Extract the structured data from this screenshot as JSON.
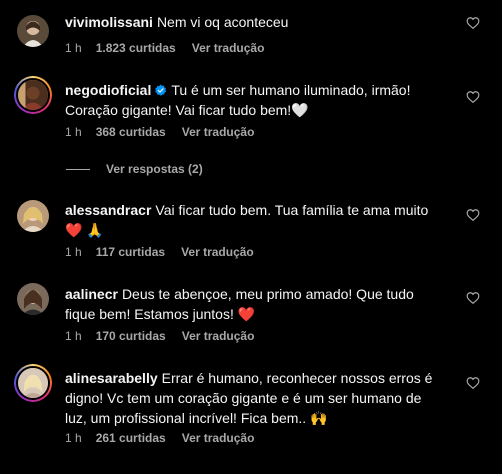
{
  "comments": [
    {
      "username": "vivimolissani",
      "text": "Nem vi oq aconteceu",
      "time": "1 h",
      "likes": "1.823 curtidas",
      "translate": "Ver tradução"
    },
    {
      "username": "negodioficial",
      "verified": true,
      "text": "Tu é um ser humano iluminado, irmão! Coração gigante! Vai ficar tudo bem!🤍",
      "time": "1 h",
      "likes": "368 curtidas",
      "translate": "Ver tradução",
      "replies": "Ver respostas (2)"
    },
    {
      "username": "alessandracr",
      "text": "Vai ficar tudo bem. Tua família te ama muito ❤️ 🙏",
      "time": "1 h",
      "likes": "117 curtidas",
      "translate": "Ver tradução"
    },
    {
      "username": "aalinecr",
      "text": "Deus te abençoe, meu primo amado! Que tudo fique bem! Estamos juntos! ❤️",
      "time": "1 h",
      "likes": "170 curtidas",
      "translate": "Ver tradução"
    },
    {
      "username": "alinesarabelly",
      "text": "Errar é humano, reconhecer nossos erros é digno! Vc tem um coração gigante e é um ser humano de luz, um profissional incrível! Fica bem.. 🙌",
      "time": "1 h",
      "likes": "261 curtidas",
      "translate": "Ver tradução"
    }
  ],
  "colors": {
    "background": "#000000",
    "text": "#f5f5f5",
    "meta": "#a8a8a8",
    "verified": "#0095f6"
  }
}
